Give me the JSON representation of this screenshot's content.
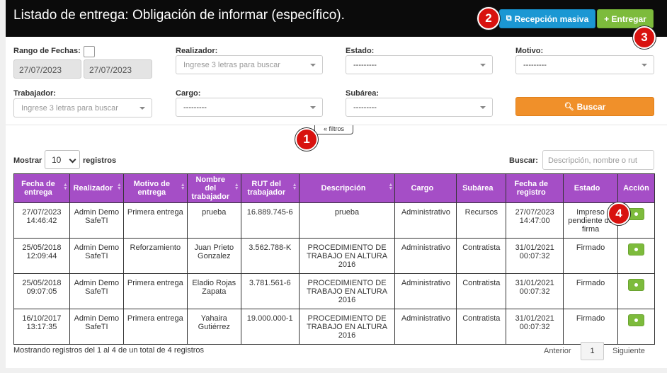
{
  "header": {
    "title": "Listado de entrega: Obligación de informar (específico).",
    "bulk_button": "Recepción masiva",
    "deliver_button": "+ Entregar"
  },
  "annotations": [
    "1",
    "2",
    "3",
    "4"
  ],
  "filters": {
    "date_range_label": "Rango de Fechas:",
    "date_from": "27/07/2023",
    "date_to": "27/07/2023",
    "realizador_label": "Realizador:",
    "realizador_placeholder": "Ingrese 3 letras para buscar",
    "estado_label": "Estado:",
    "estado_value": "---------",
    "motivo_label": "Motivo:",
    "motivo_value": "---------",
    "trabajador_label": "Trabajador:",
    "trabajador_placeholder": "Ingrese 3 letras para buscar",
    "cargo_label": "Cargo:",
    "cargo_value": "---------",
    "subarea_label": "Subárea:",
    "subarea_value": "---------",
    "search_button": "Buscar",
    "toggle_label": "« filtros"
  },
  "table_controls": {
    "show_label": "Mostrar",
    "page_length": "10",
    "records_label": "registros",
    "search_label": "Buscar:",
    "search_placeholder": "Descripción, nombre o rut"
  },
  "table": {
    "columns": [
      "Fecha de entrega",
      "Realizador",
      "Motivo de entrega",
      "Nombre del trabajador",
      "RUT del trabajador",
      "Descripción",
      "Cargo",
      "Subárea",
      "Fecha de registro",
      "Estado",
      "Acción"
    ],
    "rows": [
      [
        "27/07/2023 14:46:42",
        "Admin Demo SafeTI",
        "Primera entrega",
        "prueba",
        "16.889.745-6",
        "prueba",
        "Administrativo",
        "Recursos",
        "27/07/2023 14:47:00",
        "Impreso pendiente de firma"
      ],
      [
        "25/05/2018 12:09:44",
        "Admin Demo SafeTI",
        "Reforzamiento",
        "Juan Prieto Gonzalez",
        "3.562.788-K",
        "PROCEDIMIENTO DE TRABAJO EN ALTURA 2016",
        "Administrativo",
        "Contratista",
        "31/01/2021 00:07:32",
        "Firmado"
      ],
      [
        "25/05/2018 09:07:05",
        "Admin Demo SafeTI",
        "Primera entrega",
        "Eladio Rojas Zapata",
        "3.781.561-6",
        "PROCEDIMIENTO DE TRABAJO EN ALTURA 2016",
        "Administrativo",
        "Contratista",
        "31/01/2021 00:07:32",
        "Firmado"
      ],
      [
        "16/10/2017 13:17:35",
        "Admin Demo SafeTI",
        "Primera entrega",
        "Yahaira Gutiérrez",
        "19.000.000-1",
        "PROCEDIMIENTO DE TRABAJO EN ALTURA 2016",
        "Administrativo",
        "Contratista",
        "31/01/2021 00:07:32",
        "Firmado"
      ]
    ]
  },
  "footer": {
    "info": "Mostrando registros del 1 al 4 de un total de 4 registros",
    "prev": "Anterior",
    "page": "1",
    "next": "Siguiente"
  },
  "colors": {
    "header_bg": "#0b0b0b",
    "table_header": "#a54ec6",
    "bulk_button": "#1b97d3",
    "deliver_button": "#7dbb3c",
    "search_button": "#f0902a",
    "annotation_badge": "#d8120f"
  }
}
